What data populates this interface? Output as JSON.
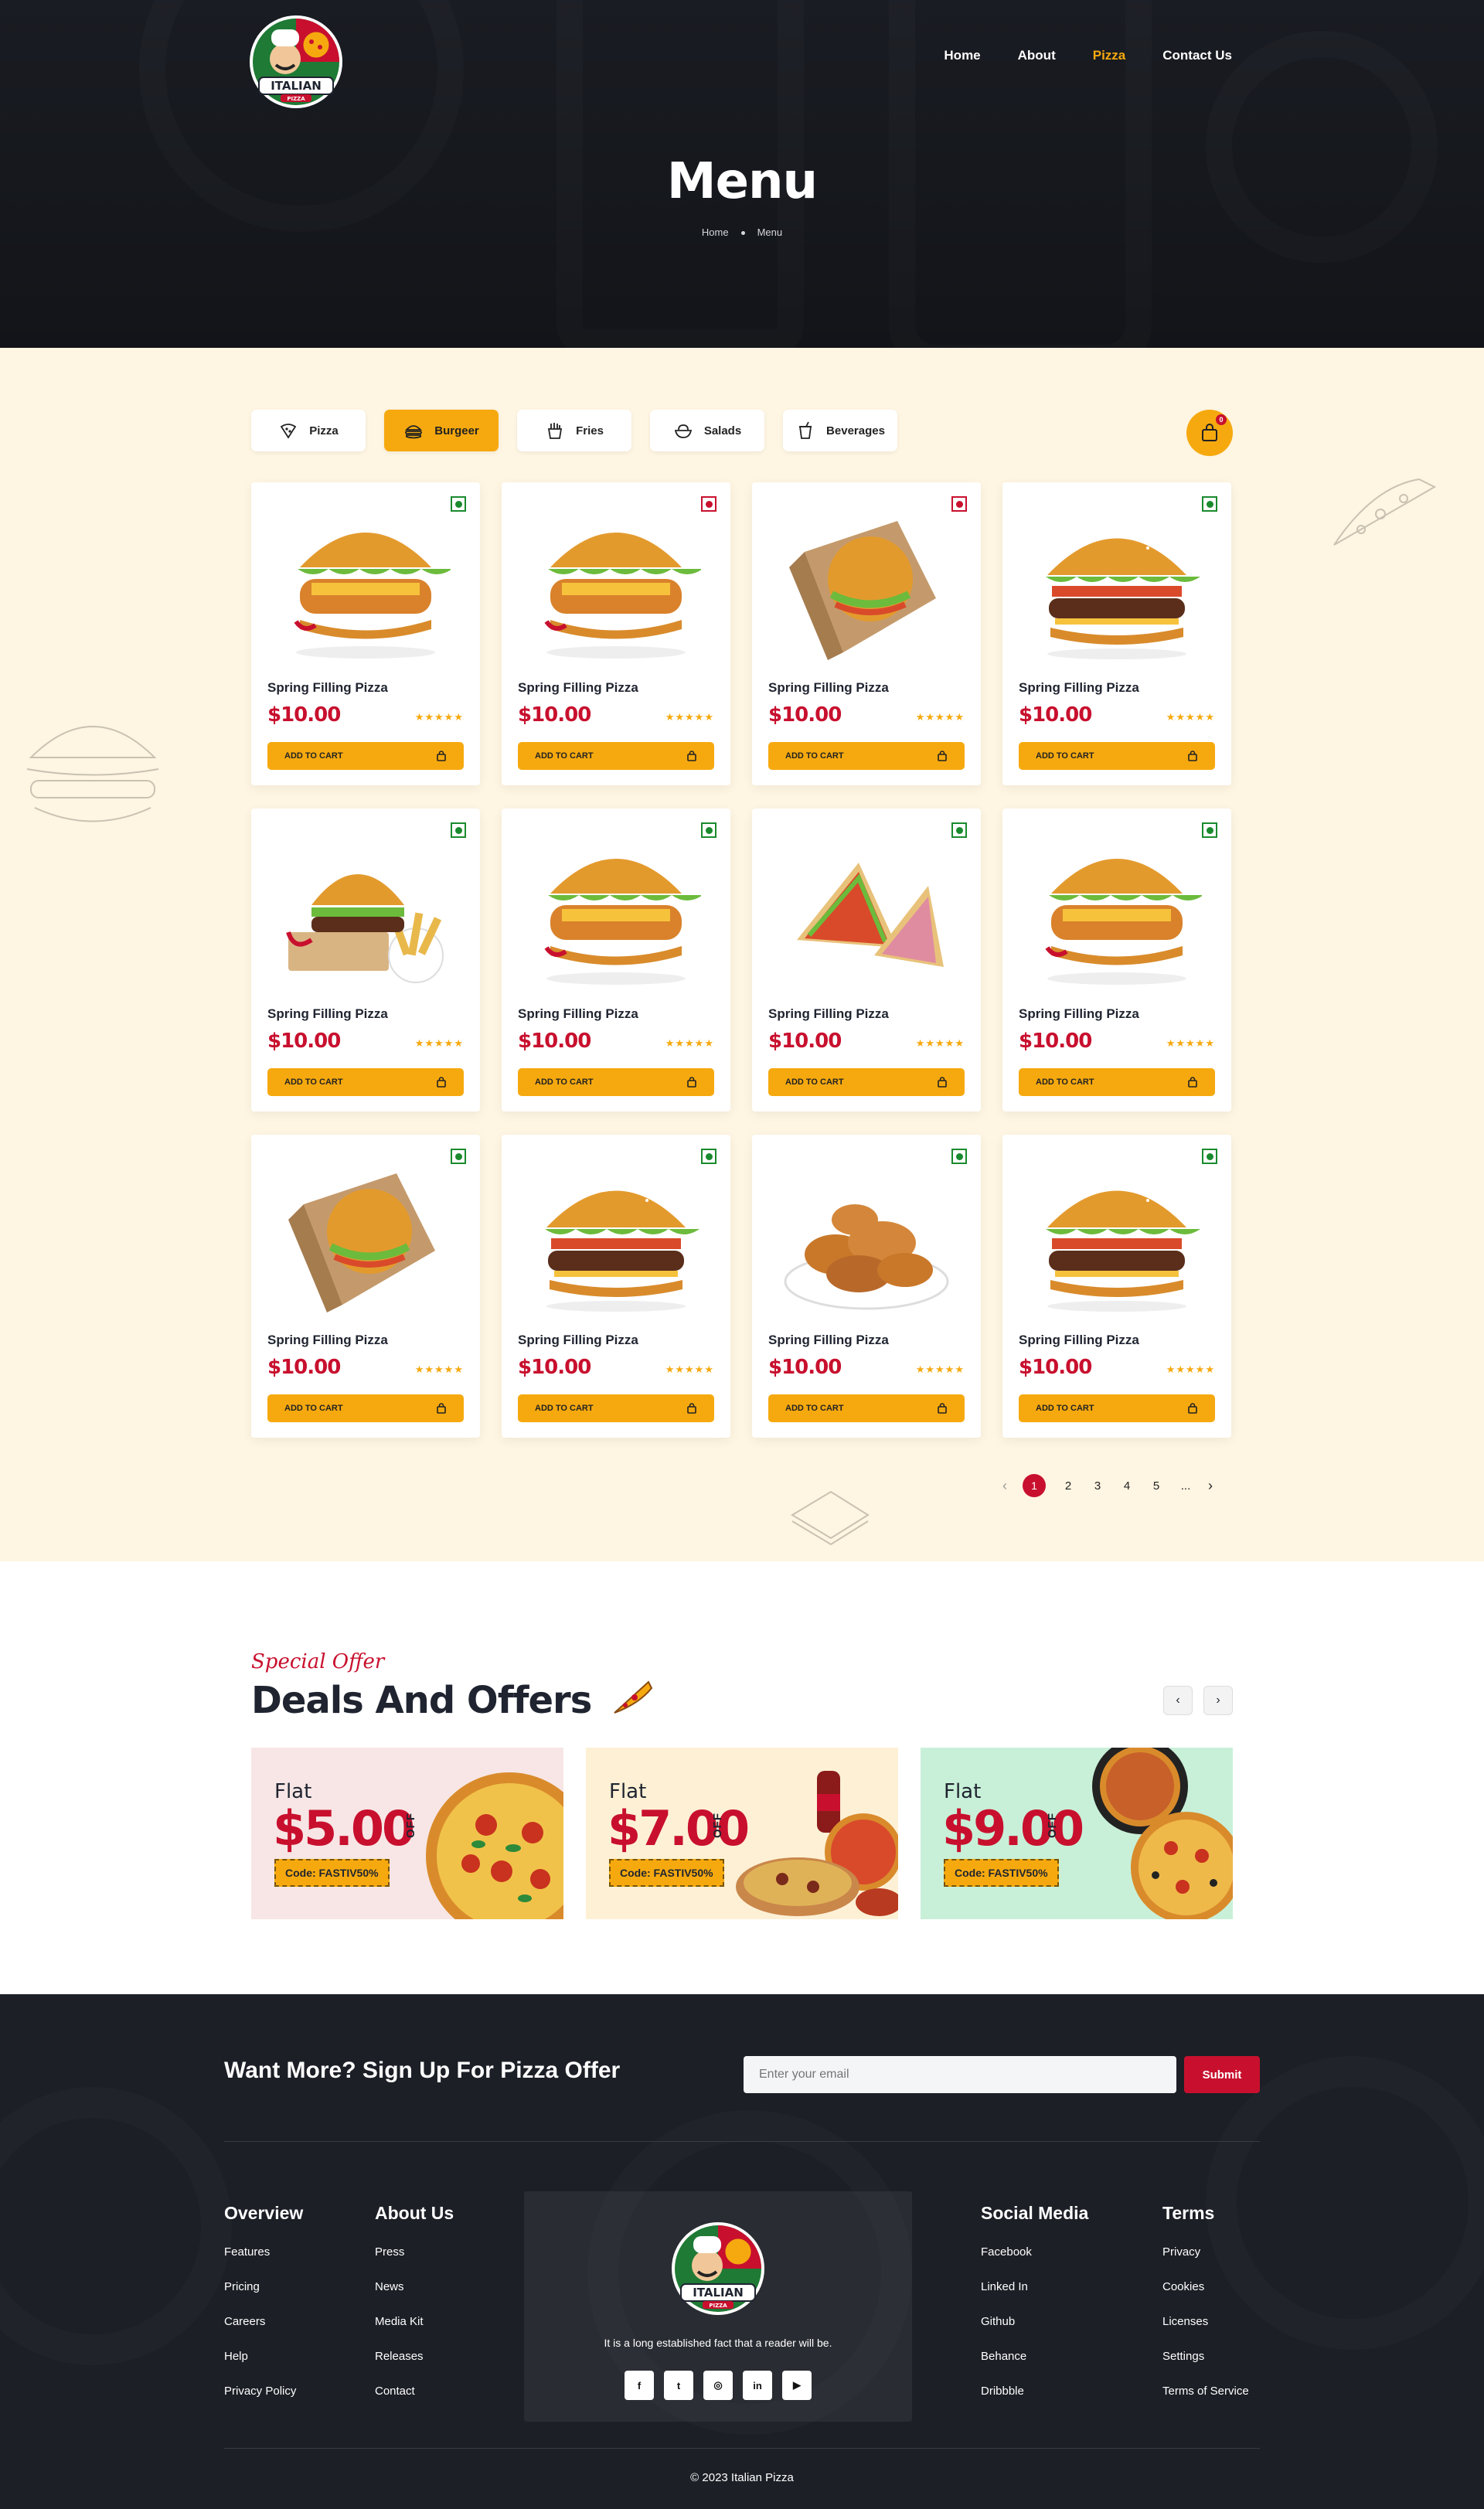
{
  "nav": {
    "items": [
      "Home",
      "About",
      "Pizza",
      "Contact Us"
    ],
    "active": "Pizza"
  },
  "logo": {
    "text": "ITALIAN",
    "subtext": "PIZZA"
  },
  "hero": {
    "title": "Menu",
    "breadcrumb": [
      "Home",
      "Menu"
    ]
  },
  "filters": [
    {
      "label": "Pizza",
      "icon": "pizza-slice-icon"
    },
    {
      "label": "Burgeer",
      "icon": "burger-icon",
      "active": true
    },
    {
      "label": "Fries",
      "icon": "fries-icon"
    },
    {
      "label": "Salads",
      "icon": "salad-bowl-icon"
    },
    {
      "label": "Beverages",
      "icon": "beverage-cup-icon"
    }
  ],
  "cart": {
    "count": "0",
    "icon": "shopping-bag-icon"
  },
  "products": [
    {
      "name": "Spring Filling Pizza",
      "price": "$10.00",
      "rating": "★★★★★",
      "cta": "ADD TO CART",
      "veg": true,
      "image": "crispy-chicken-burger"
    },
    {
      "name": "Spring Filling Pizza",
      "price": "$10.00",
      "rating": "★★★★★",
      "cta": "ADD TO CART",
      "veg": false,
      "image": "crispy-chicken-burger"
    },
    {
      "name": "Spring Filling Pizza",
      "price": "$10.00",
      "rating": "★★★★★",
      "cta": "ADD TO CART",
      "veg": false,
      "image": "boxed-burger"
    },
    {
      "name": "Spring Filling Pizza",
      "price": "$10.00",
      "rating": "★★★★★",
      "cta": "ADD TO CART",
      "veg": true,
      "image": "beef-burger"
    },
    {
      "name": "Spring Filling Pizza",
      "price": "$10.00",
      "rating": "★★★★★",
      "cta": "ADD TO CART",
      "veg": true,
      "image": "burger-with-fries"
    },
    {
      "name": "Spring Filling Pizza",
      "price": "$10.00",
      "rating": "★★★★★",
      "cta": "ADD TO CART",
      "veg": true,
      "image": "crispy-chicken-burger"
    },
    {
      "name": "Spring Filling Pizza",
      "price": "$10.00",
      "rating": "★★★★★",
      "cta": "ADD TO CART",
      "veg": true,
      "image": "sandwich"
    },
    {
      "name": "Spring Filling Pizza",
      "price": "$10.00",
      "rating": "★★★★★",
      "cta": "ADD TO CART",
      "veg": true,
      "image": "crispy-chicken-burger"
    },
    {
      "name": "Spring Filling Pizza",
      "price": "$10.00",
      "rating": "★★★★★",
      "cta": "ADD TO CART",
      "veg": true,
      "image": "boxed-burger"
    },
    {
      "name": "Spring Filling Pizza",
      "price": "$10.00",
      "rating": "★★★★★",
      "cta": "ADD TO CART",
      "veg": true,
      "image": "beef-burger"
    },
    {
      "name": "Spring Filling Pizza",
      "price": "$10.00",
      "rating": "★★★★★",
      "cta": "ADD TO CART",
      "veg": true,
      "image": "fried-chicken"
    },
    {
      "name": "Spring Filling Pizza",
      "price": "$10.00",
      "rating": "★★★★★",
      "cta": "ADD TO CART",
      "veg": true,
      "image": "beef-burger"
    }
  ],
  "pagination": {
    "pages": [
      "1",
      "2",
      "3",
      "4",
      "5",
      "..."
    ],
    "current": "1"
  },
  "deals": {
    "kicker": "Special Offer",
    "title": "Deals And Offers",
    "offers": [
      {
        "flat": "Flat",
        "amount": "$5.00",
        "off": "OFF",
        "code": "Code: FASTIV50%",
        "bg": "#f7e6e5"
      },
      {
        "flat": "Flat",
        "amount": "$7.00",
        "off": "OFF",
        "code": "Code: FASTIV50%",
        "bg": "#fdf0d5"
      },
      {
        "flat": "Flat",
        "amount": "$9.00",
        "off": "OFF",
        "code": "Code: FASTIV50%",
        "bg": "#c8f0d8"
      }
    ]
  },
  "footer": {
    "signup_title": "Want More? Sign Up For Pizza Offer",
    "email_placeholder": "Enter your email",
    "submit": "Submit",
    "columns": [
      {
        "title": "Overview",
        "links": [
          "Features",
          "Pricing",
          "Careers",
          "Help",
          "Privacy Policy"
        ]
      },
      {
        "title": "About Us",
        "links": [
          "Press",
          "News",
          "Media Kit",
          "Releases",
          "Contact"
        ]
      },
      {
        "title": "Social Media",
        "links": [
          "Facebook",
          "Linked In",
          "Github",
          "Behance",
          "Dribbble"
        ]
      },
      {
        "title": "Terms",
        "links": [
          "Privacy",
          "Cookies",
          "Licenses",
          "Settings",
          "Terms of Service"
        ]
      }
    ],
    "tagline": "It is a long established fact that a reader will be.",
    "socials": [
      {
        "glyph": "f",
        "icon": "facebook-icon"
      },
      {
        "glyph": "t",
        "icon": "twitter-icon"
      },
      {
        "glyph": "◎",
        "icon": "instagram-icon"
      },
      {
        "glyph": "in",
        "icon": "linkedin-icon"
      },
      {
        "glyph": "▶",
        "icon": "youtube-icon"
      }
    ],
    "copyright": "© 2023 Italian Pizza"
  },
  "colors": {
    "accent": "#f6a90f",
    "brand_red": "#c8102e",
    "dark": "#1c1f26",
    "cream": "#fef5e2"
  }
}
